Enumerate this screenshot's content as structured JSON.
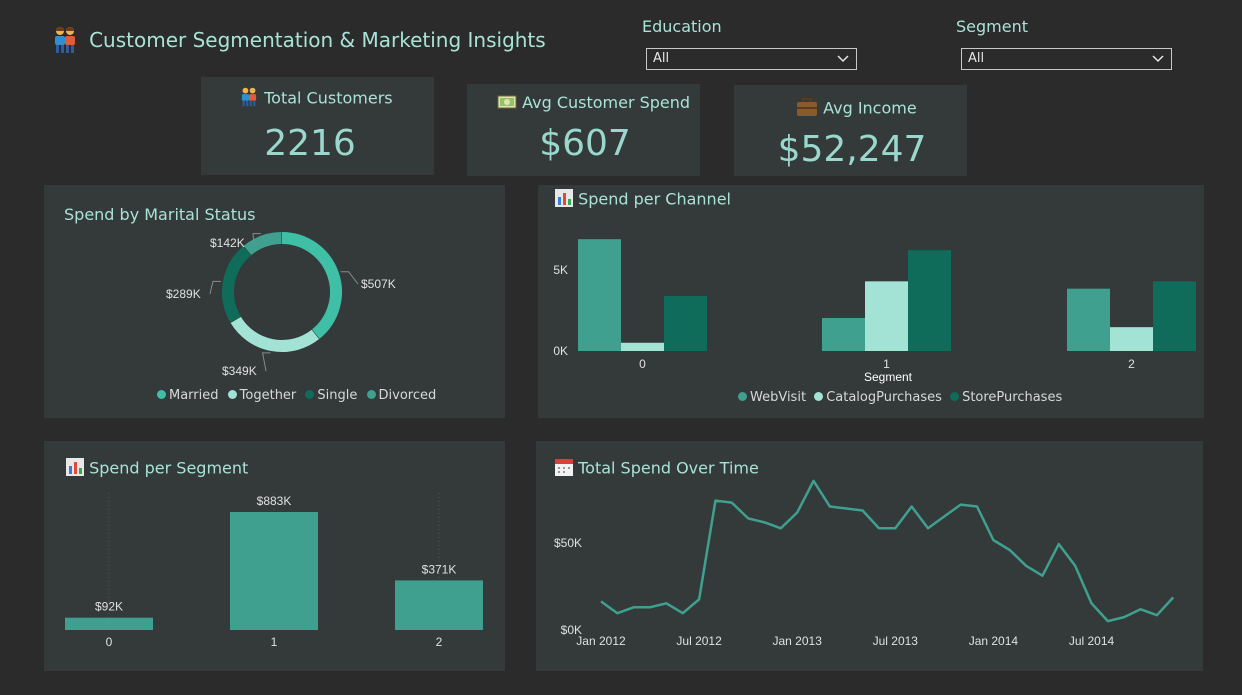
{
  "header": {
    "title": "Customer Segmentation & Marketing Insights"
  },
  "filters": [
    {
      "label": "Education",
      "value": "All"
    },
    {
      "label": "Segment",
      "value": "All"
    }
  ],
  "kpis": [
    {
      "title": "Total Customers",
      "value": "2216",
      "icon": "people-icon"
    },
    {
      "title": "Avg Customer Spend",
      "value": "$607",
      "icon": "money-icon"
    },
    {
      "title": "Avg Income",
      "value": "$52,247",
      "icon": "briefcase-icon"
    }
  ],
  "colors": {
    "teal": "#3fa08f",
    "light": "#a3e3d6",
    "dark": "#0f6b5a",
    "accent": "#3fbfa6"
  },
  "chart_data": [
    {
      "type": "pie",
      "title": "Spend by Marital Status",
      "labels": [
        "Married",
        "Together",
        "Single",
        "Divorced"
      ],
      "values": [
        507,
        349,
        289,
        142
      ],
      "data_labels": [
        "$507K",
        "$349K",
        "$289K",
        "$142K"
      ]
    },
    {
      "type": "bar",
      "title": "Spend per Channel",
      "xlabel": "Segment",
      "categories": [
        "0",
        "1",
        "2"
      ],
      "series": [
        {
          "name": "WebVisit",
          "values": [
            6100,
            1800,
            3400
          ]
        },
        {
          "name": "CatalogPurchases",
          "values": [
            450,
            3800,
            1300
          ]
        },
        {
          "name": "StorePurchases",
          "values": [
            3000,
            5500,
            3800
          ]
        }
      ],
      "yticks": [
        "0K",
        "5K"
      ],
      "ylim": [
        0,
        6000
      ]
    },
    {
      "type": "bar",
      "title": "Spend per Segment",
      "categories": [
        "0",
        "1",
        "2"
      ],
      "values": [
        92,
        883,
        371
      ],
      "data_labels": [
        "$92K",
        "$883K",
        "$371K"
      ]
    },
    {
      "type": "line",
      "title": "Total Spend Over Time",
      "x": [
        "2012-01",
        "2012-02",
        "2012-03",
        "2012-04",
        "2012-05",
        "2012-06",
        "2012-07",
        "2012-08",
        "2012-09",
        "2012-10",
        "2012-11",
        "2012-12",
        "2013-01",
        "2013-02",
        "2013-03",
        "2013-04",
        "2013-05",
        "2013-06",
        "2013-07",
        "2013-08",
        "2013-09",
        "2013-10",
        "2013-11",
        "2013-12",
        "2014-01",
        "2014-02",
        "2014-03",
        "2014-04",
        "2014-05",
        "2014-06",
        "2014-07",
        "2014-08",
        "2014-09",
        "2014-10",
        "2014-11",
        "2014-12",
        "2015-01"
      ],
      "values": [
        14,
        8,
        11,
        11,
        13,
        8,
        15,
        65,
        64,
        56,
        54,
        51,
        59,
        75,
        62,
        61,
        60,
        51,
        51,
        62,
        51,
        57,
        63,
        62,
        45,
        40,
        32,
        27,
        43,
        32,
        13,
        4,
        6,
        10,
        7,
        16,
        null
      ],
      "xticks": [
        "Jan 2012",
        "Jul 2012",
        "Jan 2013",
        "Jul 2013",
        "Jan 2014",
        "Jul 2014"
      ],
      "yticks": [
        "$0K",
        "$50K"
      ],
      "ylim": [
        0,
        80
      ]
    }
  ]
}
